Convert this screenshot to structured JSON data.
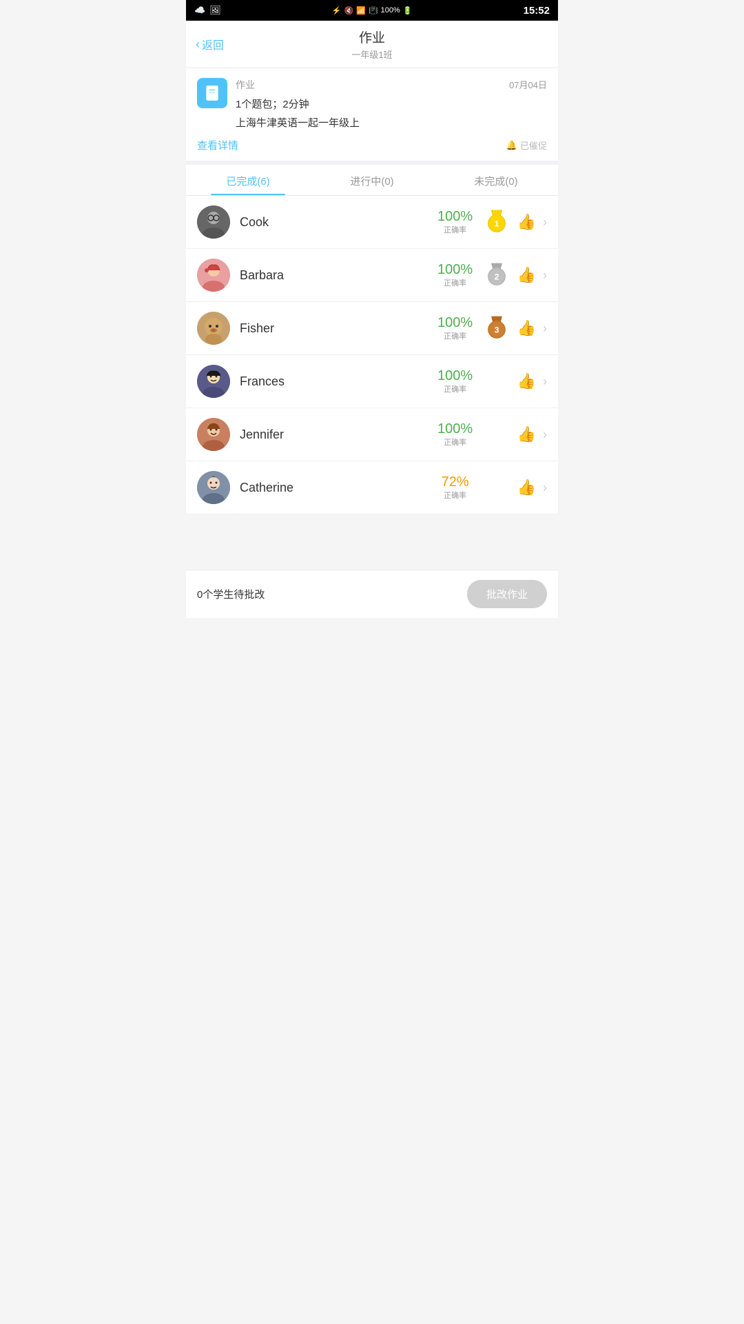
{
  "statusBar": {
    "time": "15:52",
    "battery": "100%"
  },
  "header": {
    "title": "作业",
    "subtitle": "一年级1班",
    "backLabel": "返回"
  },
  "assignment": {
    "label": "作业",
    "date": "07月04日",
    "desc1": "1个题包；2分钟",
    "desc2": "上海牛津英语一起一年级上",
    "viewDetail": "查看详情",
    "reminded": "已催促"
  },
  "tabs": [
    {
      "label": "已完成(6)",
      "active": true
    },
    {
      "label": "进行中(0)",
      "active": false
    },
    {
      "label": "未完成(0)",
      "active": false
    }
  ],
  "students": [
    {
      "id": "cook",
      "name": "Cook",
      "score": "100%",
      "scoreClass": "green",
      "medal": "1",
      "medalColor": "gold",
      "avatarEmoji": "🧑‍🦳"
    },
    {
      "id": "barbara",
      "name": "Barbara",
      "score": "100%",
      "scoreClass": "green",
      "medal": "2",
      "medalColor": "silver",
      "avatarEmoji": "👧"
    },
    {
      "id": "fisher",
      "name": "Fisher",
      "score": "100%",
      "scoreClass": "green",
      "medal": "3",
      "medalColor": "bronze",
      "avatarEmoji": "🐶"
    },
    {
      "id": "frances",
      "name": "Frances",
      "score": "100%",
      "scoreClass": "green",
      "medal": "",
      "medalColor": "",
      "avatarEmoji": "🧒"
    },
    {
      "id": "jennifer",
      "name": "Jennifer",
      "score": "100%",
      "scoreClass": "green",
      "medal": "",
      "medalColor": "",
      "avatarEmoji": "👦"
    },
    {
      "id": "catherine",
      "name": "Catherine",
      "score": "72%",
      "scoreClass": "orange",
      "medal": "",
      "medalColor": "",
      "avatarEmoji": "👶"
    }
  ],
  "scoreSubLabel": "正确率",
  "footer": {
    "pendingText": "0个学生待批改",
    "gradeBtnLabel": "批改作业"
  }
}
